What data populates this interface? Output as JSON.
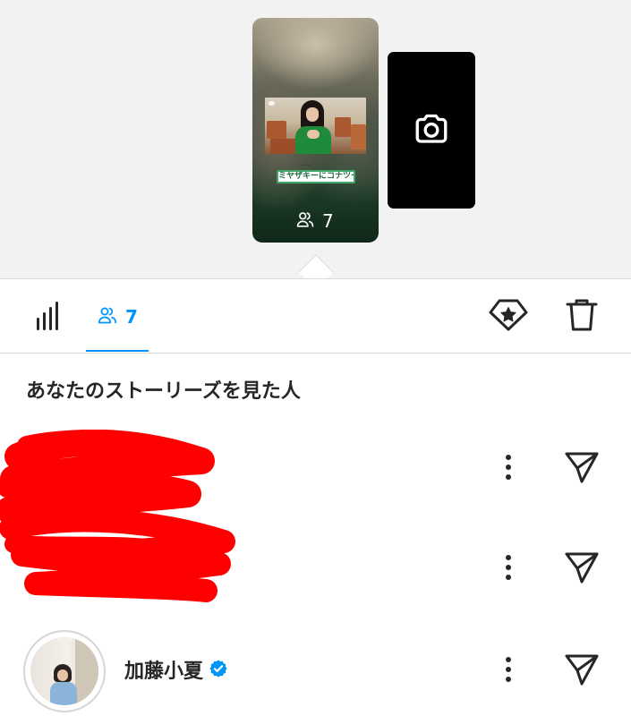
{
  "story_preview": {
    "caption_sticker": "ミヤザキーにコナツー",
    "viewer_count": "7",
    "viewer_icon": "people-icon",
    "camera_icon": "camera-icon"
  },
  "toolbar": {
    "insights_icon": "bar-chart-icon",
    "viewers_tab_count": "7",
    "viewers_tab_icon": "people-icon",
    "highlight_icon": "highlight-star-icon",
    "delete_icon": "trash-icon",
    "accent_color": "#0095f6"
  },
  "viewers_section": {
    "title": "あなたのストーリーズを見た人"
  },
  "viewers": [
    {
      "username": "",
      "redacted": true,
      "more_icon": "more-vertical-icon",
      "send_icon": "send-icon"
    },
    {
      "username": "",
      "redacted": true,
      "more_icon": "more-vertical-icon",
      "send_icon": "send-icon"
    },
    {
      "username": "加藤小夏",
      "verified": true,
      "verified_icon": "verified-badge-icon",
      "more_icon": "more-vertical-icon",
      "send_icon": "send-icon"
    }
  ],
  "colors": {
    "preview_background": "#f2f2f2",
    "verified_badge": "#0095f6",
    "redaction": "#ff0000"
  }
}
